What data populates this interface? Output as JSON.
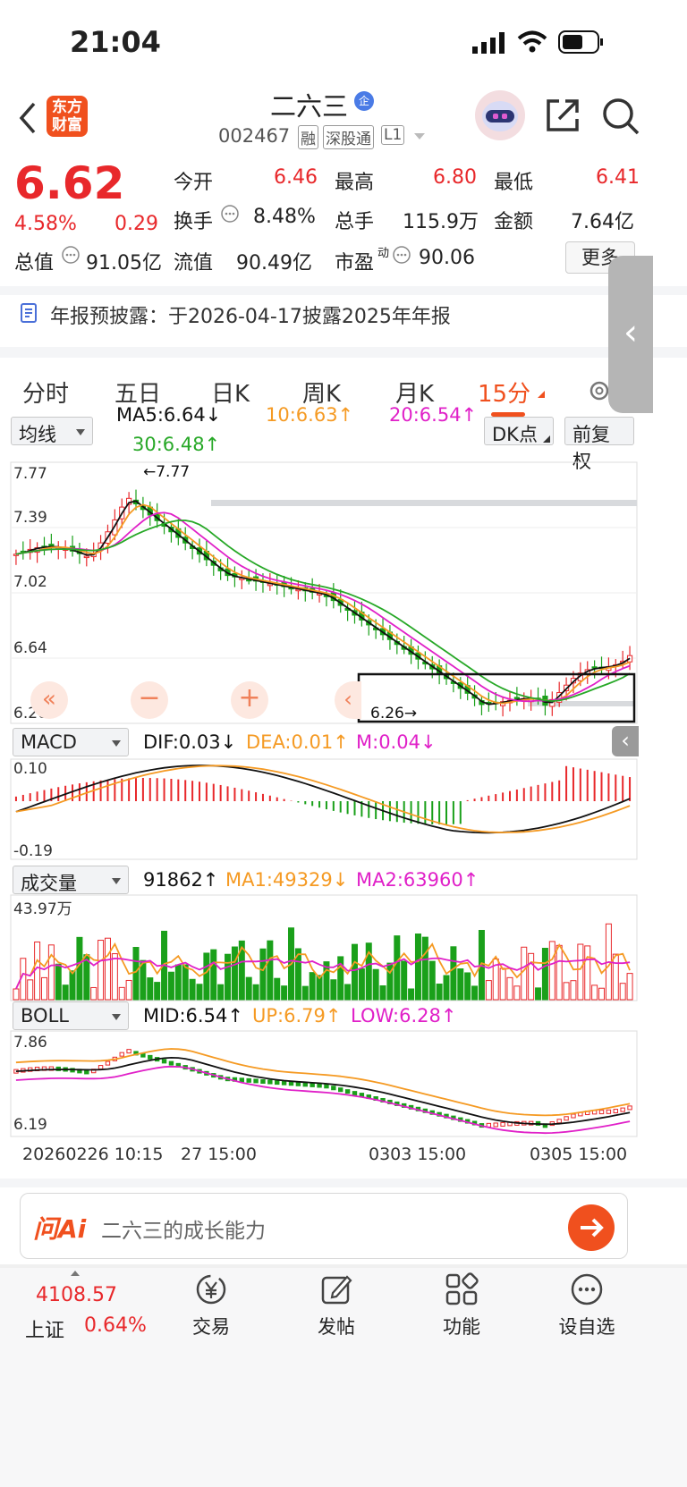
{
  "status": {
    "time": "21:04"
  },
  "header": {
    "logo_text": "东方财富",
    "stock_name": "二六三",
    "badge": "企",
    "code": "002467",
    "tags": [
      "融",
      "深股通",
      "L1"
    ]
  },
  "quote": {
    "price": "6.62",
    "change_pct": "4.58%",
    "change": "0.29",
    "open_label": "今开",
    "open": "6.46",
    "high_label": "最高",
    "high": "6.80",
    "low_label": "最低",
    "low": "6.41",
    "turnover_label": "换手",
    "turnover": "8.48%",
    "volume_label": "总手",
    "volume": "115.9万",
    "amount_label": "金额",
    "amount": "7.64亿",
    "mcap_label": "总值",
    "mcap": "91.05亿",
    "float_label": "流值",
    "float_cap": "90.49亿",
    "pe_label": "市盈",
    "pe_sup": "动",
    "pe": "90.06",
    "more_label": "更多"
  },
  "notice": {
    "text": "年报预披露：于2026-04-17披露2025年年报"
  },
  "tabs": [
    {
      "label": "分时"
    },
    {
      "label": "五日"
    },
    {
      "label": "日K"
    },
    {
      "label": "周K"
    },
    {
      "label": "月K"
    },
    {
      "label": "15分",
      "active": true
    }
  ],
  "indicators": {
    "main_select": "均线",
    "ma5": "MA5:6.64↓",
    "ma10": "10:6.63↑",
    "ma20": "20:6.54↑",
    "ma30": "30:6.48↑",
    "dk_label": "DK点",
    "adjust_label": "前复权",
    "macd_select": "MACD",
    "dif": "DIF:0.03↓",
    "dea": "DEA:0.01↑",
    "m": "M:0.04↓",
    "vol_select": "成交量",
    "vol_val": "91862↑",
    "vol_ma1": "MA1:49329↓",
    "vol_ma2": "MA2:63960↑",
    "boll_select": "BOLL",
    "mid": "MID:6.54↑",
    "up": "UP:6.79↑",
    "low": "LOW:6.28↑"
  },
  "chart_data": {
    "type": "candlestick",
    "price_axis_labels": [
      "7.77",
      "7.39",
      "7.02",
      "6.64",
      "6.26"
    ],
    "max_marker": "←7.77",
    "min_marker": "6.26→",
    "macd_axis_labels": [
      "0.10",
      "-0.19"
    ],
    "volume_axis_label": "43.97万",
    "boll_axis_labels": [
      "7.86",
      "6.19"
    ],
    "time_labels": [
      "20260226 10:15",
      "27 15:00",
      "0303 15:00",
      "0305 15:00"
    ],
    "colors": {
      "up": "#e8282b",
      "down": "#1aa01a",
      "ma5": "#111111",
      "ma10": "#f59a23",
      "ma20": "#e020c8",
      "ma30": "#27a827"
    }
  },
  "ai": {
    "logo": "问Ai",
    "placeholder": "二六三的成长能力"
  },
  "bottom": {
    "index_value": "4108.57",
    "index_name": "上证",
    "index_pct": "0.64%",
    "items": [
      {
        "label": "交易"
      },
      {
        "label": "发帖"
      },
      {
        "label": "功能"
      },
      {
        "label": "设自选"
      }
    ]
  }
}
